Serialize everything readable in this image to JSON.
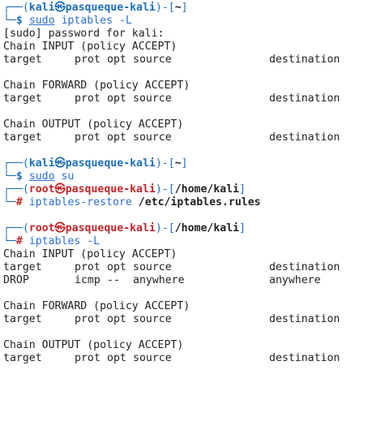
{
  "colors": {
    "prompt_user_color": "#1f6fb8",
    "root_user_color": "#c0262a",
    "command_color": "#2e6fd0",
    "text_color": "#222222",
    "background": "#ffffff"
  },
  "icons": {
    "kali_logo_glyph": "㉿"
  },
  "prompts": [
    {
      "line1_open": "┌──(",
      "user": "kali",
      "sep": "㉿",
      "host": "pasqueque-kali",
      "close_open": ")-[",
      "path": "~",
      "close": "]",
      "line2_prefix": "└─",
      "symbol": "$ ",
      "cmd_part1": "sudo",
      "cmd_part2": " iptables -L"
    },
    {
      "line1_open": "┌──(",
      "user": "kali",
      "sep": "㉿",
      "host": "pasqueque-kali",
      "close_open": ")-[",
      "path": "~",
      "close": "]",
      "line2_prefix": "└─",
      "symbol": "$ ",
      "cmd_part1": "sudo",
      "cmd_part2": " su"
    },
    {
      "line1_open": "┌──(",
      "user": "root",
      "sep": "㉿",
      "host": "pasqueque-kali",
      "close_open": ")-[",
      "path": "/home/kali",
      "close": "]",
      "line2_prefix": "└─",
      "symbol": "# ",
      "cmd_part1": "iptables-restore",
      "cmd_part2": " /etc/iptables.rules"
    },
    {
      "line1_open": "┌──(",
      "user": "root",
      "sep": "㉿",
      "host": "pasqueque-kali",
      "close_open": ")-[",
      "path": "/home/kali",
      "close": "]",
      "line2_prefix": "└─",
      "symbol": "# ",
      "cmd_part1": "iptables -L",
      "cmd_part2": ""
    }
  ],
  "output1": {
    "sudo_prompt": "[sudo] password for kali:",
    "input_chain": "Chain INPUT (policy ACCEPT)",
    "forward_chain": "Chain FORWARD (policy ACCEPT)",
    "output_chain": "Chain OUTPUT (policy ACCEPT)"
  },
  "output2": {
    "input_chain": "Chain INPUT (policy ACCEPT)",
    "forward_chain": "Chain FORWARD (policy ACCEPT)",
    "output_chain": "Chain OUTPUT (policy ACCEPT)",
    "rule": {
      "target": "DROP",
      "prot": "icmp",
      "opt": "--",
      "source": "anywhere",
      "destination": "anywhere"
    }
  },
  "table_header": {
    "target": "target",
    "prot": "prot",
    "opt": "opt",
    "source": "source",
    "destination": "destination"
  }
}
